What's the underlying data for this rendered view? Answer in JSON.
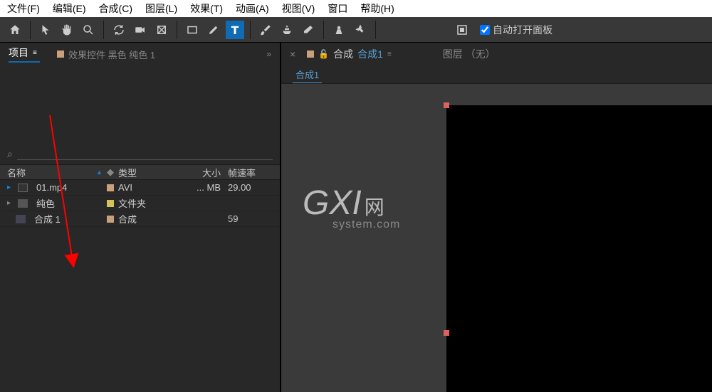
{
  "menu": [
    "文件(F)",
    "编辑(E)",
    "合成(C)",
    "图层(L)",
    "效果(T)",
    "动画(A)",
    "视图(V)",
    "窗口",
    "帮助(H)"
  ],
  "toolbar": {
    "auto_open": "自动打开面板"
  },
  "left": {
    "tab_project": "项目",
    "tab_effects": "效果控件 黑色 纯色 1",
    "search_placeholder": "",
    "headers": {
      "name": "名称",
      "type": "类型",
      "size": "大小",
      "fps": "帧速率"
    },
    "rows": [
      {
        "name": "01.mp4",
        "type": "AVI",
        "size": "... MB",
        "fps": "29.00"
      },
      {
        "name": "纯色",
        "type": "文件夹",
        "size": "",
        "fps": ""
      },
      {
        "name": "合成 1",
        "type": "合成",
        "size": "",
        "fps": "59"
      }
    ]
  },
  "right": {
    "comp_label": "合成",
    "comp_name": "合成1",
    "layer_label": "图层 （无）",
    "flow_tab": "合成1"
  },
  "watermark": {
    "main": "G",
    "xi": "XI",
    "net": "网",
    "sub": "system.com"
  }
}
